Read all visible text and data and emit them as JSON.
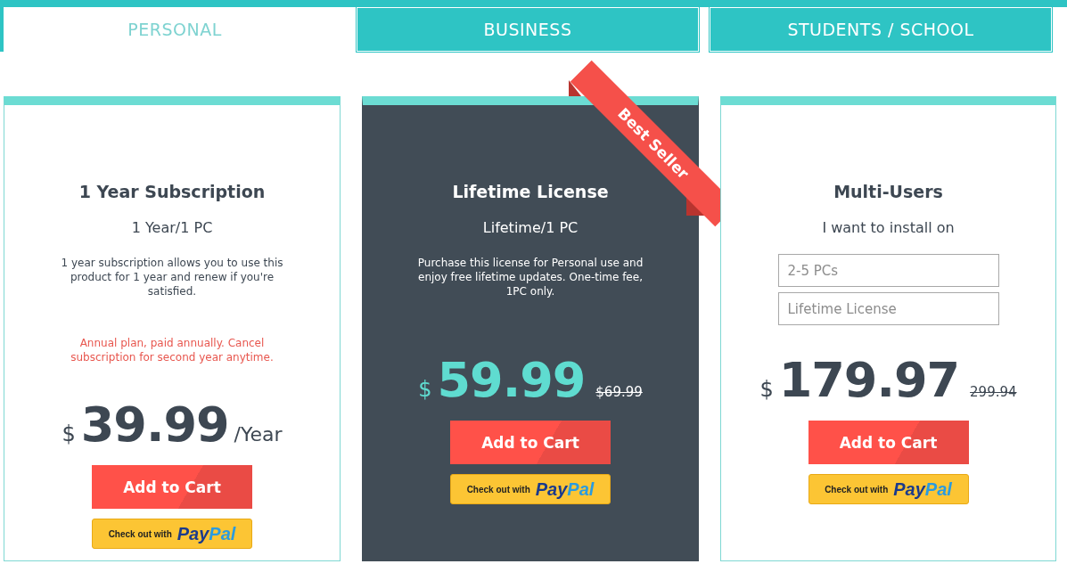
{
  "tabs": [
    {
      "label": "PERSONAL",
      "selected": true
    },
    {
      "label": "BUSINESS",
      "selected": false
    },
    {
      "label": "STUDENTS / SCHOOL",
      "selected": false
    }
  ],
  "plans": [
    {
      "kind": "single",
      "featured": false,
      "title": "1 Year Subscription",
      "subtitle": "1 Year/1 PC",
      "description": "1 year subscription allows you to use this product for 1 year and renew if you're satisfied.",
      "note": "Annual plan, paid annually. Cancel subscription for second year anytime.",
      "currency": "$",
      "amount": "39.99",
      "period": "/Year",
      "cart_button": "Add to Cart",
      "paypal": {
        "prefix": "Check out with",
        "logo": "PayPal"
      }
    },
    {
      "kind": "single",
      "featured": true,
      "ribbon": "Best Seller",
      "title": "Lifetime License",
      "subtitle": "Lifetime/1 PC",
      "description": "Purchase this license for Personal use and enjoy free lifetime updates. One-time fee, 1PC only.",
      "currency": "$",
      "amount": "59.99",
      "old_price": "$69.99",
      "cart_button": "Add to Cart",
      "paypal": {
        "prefix": "Check out with",
        "logo": "PayPal"
      }
    },
    {
      "kind": "multi",
      "featured": false,
      "title": "Multi-Users",
      "subtitle": "I want to install on",
      "fields": [
        {
          "placeholder": "2-5 PCs"
        },
        {
          "placeholder": "Lifetime License"
        }
      ],
      "currency": "$",
      "amount": "179.97",
      "old_price": "299.94",
      "cart_button": "Add to Cart",
      "paypal": {
        "prefix": "Check out with",
        "logo": "PayPal"
      }
    }
  ]
}
